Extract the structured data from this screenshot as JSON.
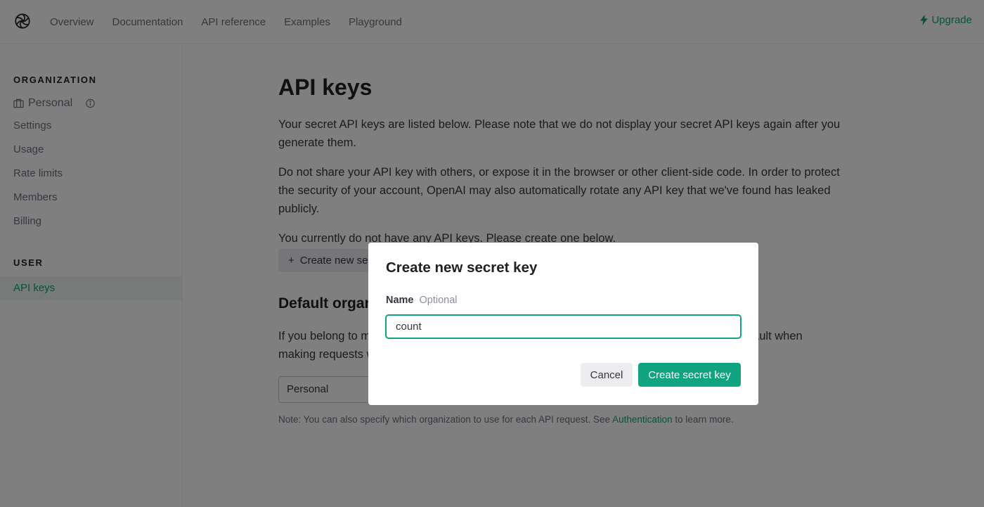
{
  "topbar": {
    "logo": "openai-logo-icon",
    "nav": [
      "Overview",
      "Documentation",
      "API reference",
      "Examples",
      "Playground"
    ],
    "upgrade": {
      "icon": "lightning-bolt-icon",
      "label": "Upgrade"
    }
  },
  "sidebar": {
    "org_section": "ORGANIZATION",
    "org_name": "Personal",
    "org_items": [
      "Settings",
      "Usage",
      "Rate limits",
      "Members",
      "Billing"
    ],
    "user_section": "USER",
    "user_items": [
      "API keys"
    ],
    "active_item": "API keys"
  },
  "main": {
    "title": "API keys",
    "para1": "Your secret API keys are listed below. Please note that we do not display your secret API keys again after you generate them.",
    "para2": "Do not share your API key with others, or expose it in the browser or other client-side code. In order to protect the security of your account, OpenAI may also automatically rotate any API key that we've found has leaked publicly.",
    "para3": "You currently do not have any API keys. Please create one below.",
    "create_button": "Create new secret key",
    "default_org_title": "Default organization",
    "default_org_text": "If you belong to multiple organizations, this setting controls which organization is used by default when making requests with the API keys above.",
    "org_select_value": "Personal",
    "note_prefix": "Note: You can also specify which organization to use for each API request. See ",
    "note_link": "Authentication",
    "note_suffix": " to learn more."
  },
  "modal": {
    "title": "Create new secret key",
    "field_label": "Name",
    "field_optional": "Optional",
    "input_value": "count",
    "cancel": "Cancel",
    "submit": "Create secret key"
  },
  "colors": {
    "accent": "#10a37f",
    "overlay": "rgba(0,0,0,0.5)"
  }
}
